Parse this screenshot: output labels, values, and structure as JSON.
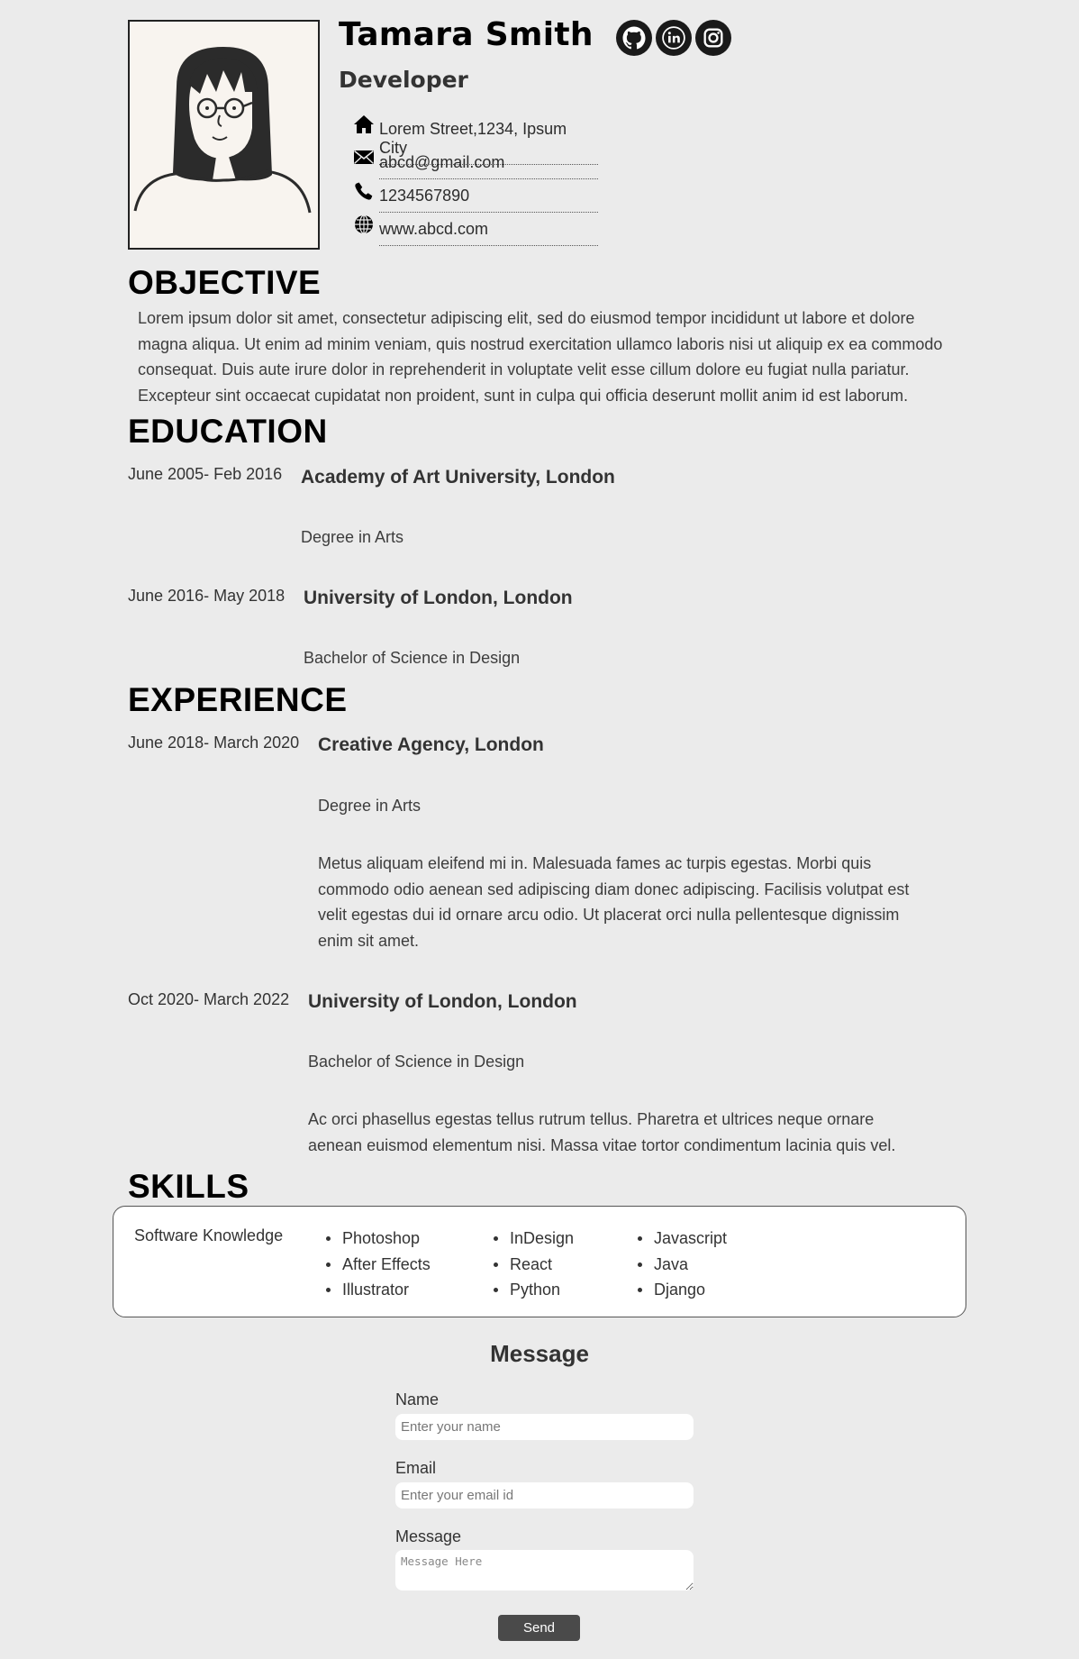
{
  "profile": {
    "name": "Tamara Smith",
    "role": "Developer",
    "contacts": {
      "address": "Lorem Street,1234, Ipsum City",
      "email": "abcd@gmail.com",
      "phone": "1234567890",
      "website": "www.abcd.com"
    },
    "socials": [
      "github-icon",
      "linkedin-icon",
      "instagram-icon"
    ]
  },
  "objective": {
    "heading": "OBJECTIVE",
    "text": "Lorem ipsum dolor sit amet, consectetur adipiscing elit, sed do eiusmod tempor incididunt ut labore et dolore magna aliqua. Ut enim ad minim veniam, quis nostrud exercitation ullamco laboris nisi ut aliquip ex ea commodo consequat. Duis aute irure dolor in reprehenderit in voluptate velit esse cillum dolore eu fugiat nulla pariatur. Excepteur sint occaecat cupidatat non proident, sunt in culpa qui officia deserunt mollit anim id est laborum."
  },
  "education": {
    "heading": "EDUCATION",
    "items": [
      {
        "date": "June 2005- Feb 2016",
        "title": "Academy of Art University, London",
        "subtitle": "Degree in Arts"
      },
      {
        "date": "June 2016- May 2018",
        "title": "University of London, London",
        "subtitle": "Bachelor of Science in Design"
      }
    ]
  },
  "experience": {
    "heading": "EXPERIENCE",
    "items": [
      {
        "date": "June 2018- March 2020",
        "title": "Creative Agency, London",
        "subtitle": "Degree in Arts",
        "description": "Metus aliquam eleifend mi in. Malesuada fames ac turpis egestas. Morbi quis commodo odio aenean sed adipiscing diam donec adipiscing. Facilisis volutpat est velit egestas dui id ornare arcu odio. Ut placerat orci nulla pellentesque dignissim enim sit amet."
      },
      {
        "date": "Oct 2020- March 2022",
        "title": "University of London, London",
        "subtitle": "Bachelor of Science in Design",
        "description": "Ac orci phasellus egestas tellus rutrum tellus. Pharetra et ultrices neque ornare aenean euismod elementum nisi. Massa vitae tortor condimentum lacinia quis vel."
      }
    ]
  },
  "skills": {
    "heading": "SKILLS",
    "label": "Software Knowledge",
    "columns": [
      [
        "Photoshop",
        "After Effects",
        "Illustrator"
      ],
      [
        "InDesign",
        "React",
        "Python"
      ],
      [
        "Javascript",
        "Java",
        "Django"
      ]
    ]
  },
  "message_form": {
    "title": "Message",
    "name_label": "Name",
    "name_placeholder": "Enter your name",
    "email_label": "Email",
    "email_placeholder": "Enter your email id",
    "message_label": "Message",
    "message_placeholder": "Message Here",
    "send_label": "Send"
  }
}
